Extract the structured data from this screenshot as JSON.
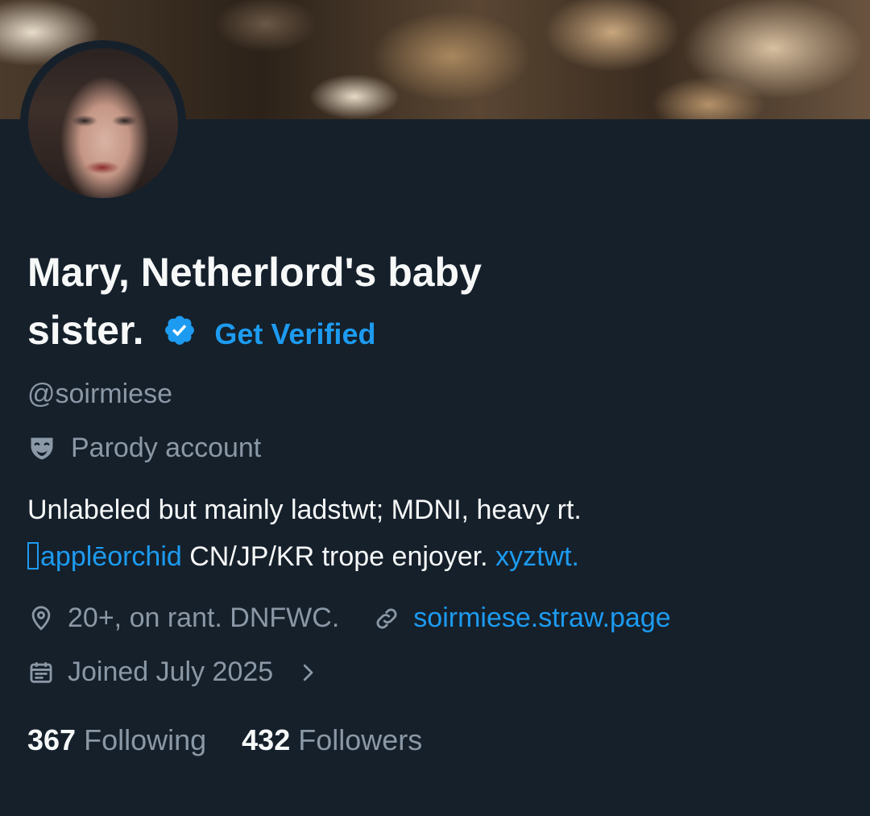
{
  "profile": {
    "display_name_line1": "Mary, Netherlord's baby",
    "display_name_line2": "sister.",
    "get_verified": "Get Verified",
    "handle": "@soirmiese",
    "parody_label": "Parody account"
  },
  "bio": {
    "line1": "Unlabeled but mainly ladstwt; MDNI, heavy rt.",
    "mention": "applēorchid",
    "line2_text": " CN/JP/KR trope enjoyer. ",
    "hashtag": "xyztwt."
  },
  "meta": {
    "location": "20+, on rant. DNFWC.",
    "website": "soirmiese.straw.page",
    "joined": "Joined July 2025"
  },
  "stats": {
    "following_count": "367",
    "following_label": "Following",
    "followers_count": "432",
    "followers_label": "Followers"
  },
  "icons": {
    "verified": "verified-badge-icon",
    "parody": "theater-mask-icon",
    "location": "location-pin-icon",
    "link": "link-icon",
    "calendar": "calendar-icon",
    "chevron": "chevron-right-icon"
  },
  "colors": {
    "background": "#15202b",
    "accent": "#1d9bf0",
    "muted": "#8b98a5",
    "text": "#f7f9f9"
  }
}
